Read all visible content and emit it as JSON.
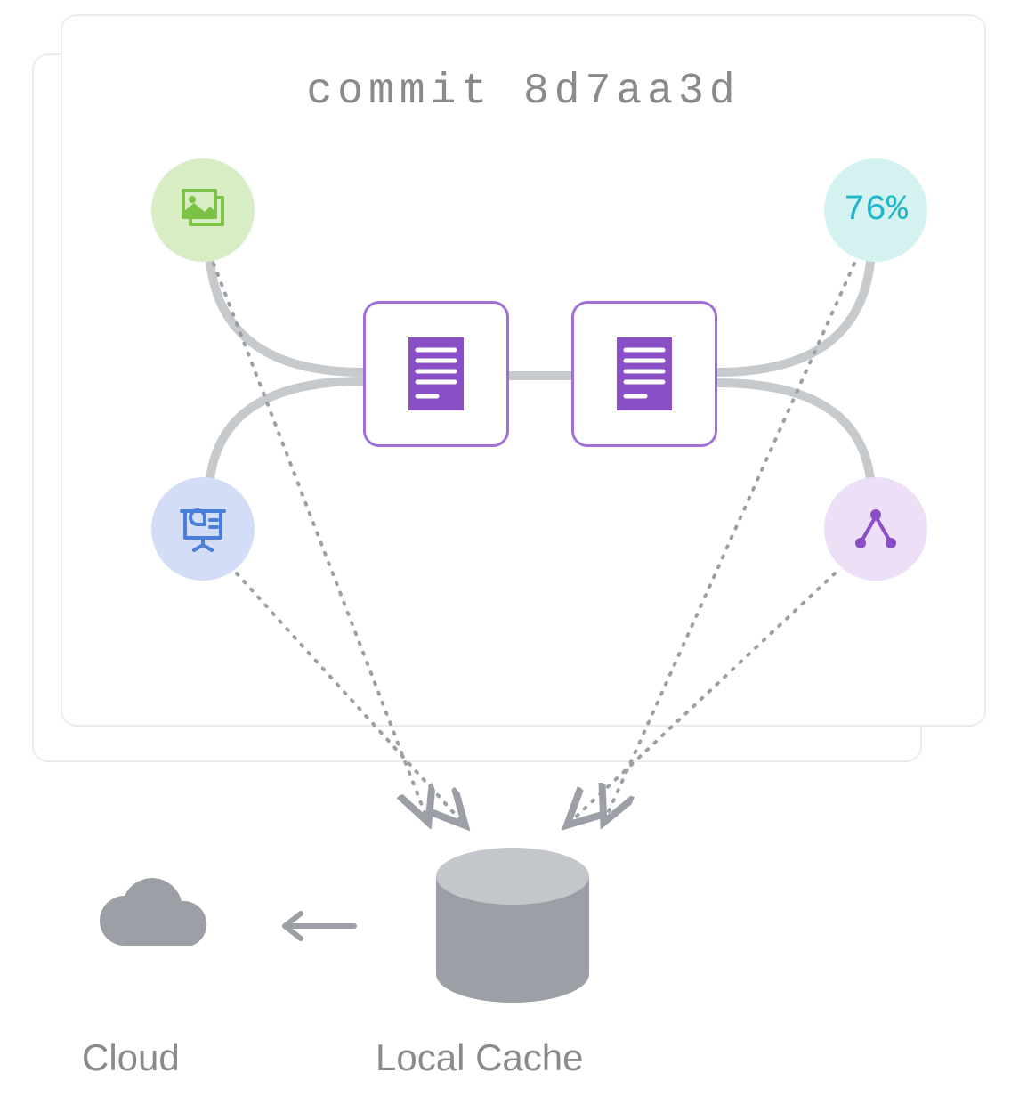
{
  "commit": {
    "prefix": "commit",
    "hash": "8d7aa3d"
  },
  "nodes": {
    "images": {
      "name": "images-icon"
    },
    "percent": {
      "value": "76%"
    },
    "presentation": {
      "name": "presentation-icon"
    },
    "graph": {
      "name": "graph-icon"
    }
  },
  "labels": {
    "cloud": "Cloud",
    "local_cache": "Local Cache"
  },
  "colors": {
    "green_bg": "#d9edc5",
    "green_fg": "#7cc247",
    "teal_bg": "#d4f3f0",
    "teal_fg": "#1fb6c9",
    "blue_bg": "#d3ddf7",
    "blue_fg": "#4a7fd8",
    "purple_bg": "#ecdff6",
    "purple_fg": "#8a4fc7",
    "doc_border": "#a070d8",
    "doc_fill": "#8a4fc7",
    "gray": "#9ca0a6",
    "text_gray": "#8a8a8a"
  }
}
